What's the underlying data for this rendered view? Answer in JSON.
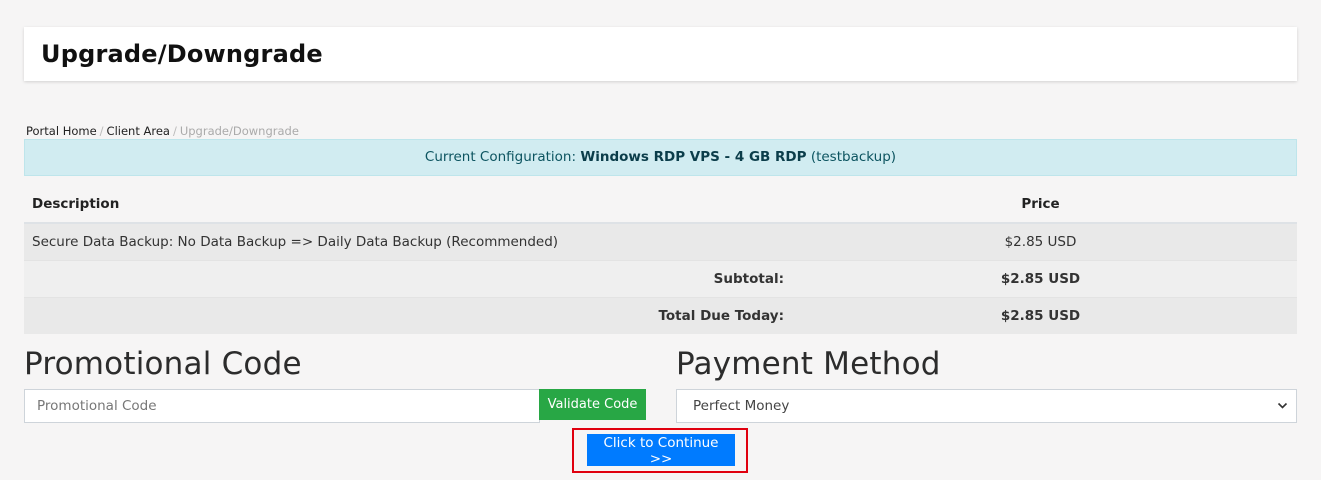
{
  "header": {
    "title": "Upgrade/Downgrade"
  },
  "breadcrumb": {
    "items": [
      "Portal Home",
      "Client Area"
    ],
    "active": "Upgrade/Downgrade",
    "separator": "/"
  },
  "config": {
    "label": "Current Configuration:",
    "product": "Windows RDP VPS - 4 GB RDP",
    "service": "(testbackup)"
  },
  "table": {
    "headers": {
      "description": "Description",
      "price": "Price"
    },
    "rows": [
      {
        "description": "Secure Data Backup: No Data Backup => Daily Data Backup (Recommended)",
        "price": "$2.85 USD"
      }
    ],
    "subtotal_label": "Subtotal:",
    "subtotal_value": "$2.85 USD",
    "total_label": "Total Due Today:",
    "total_value": "$2.85 USD"
  },
  "promo": {
    "title": "Promotional Code",
    "placeholder": "Promotional Code",
    "button_label": "Validate Code"
  },
  "payment": {
    "title": "Payment Method",
    "selected": "Perfect Money"
  },
  "continue_button": "Click to Continue >>",
  "colors": {
    "info_bg": "#d1ecf1",
    "success": "#28a745",
    "primary": "#007bff",
    "highlight_border": "#e0000f"
  }
}
